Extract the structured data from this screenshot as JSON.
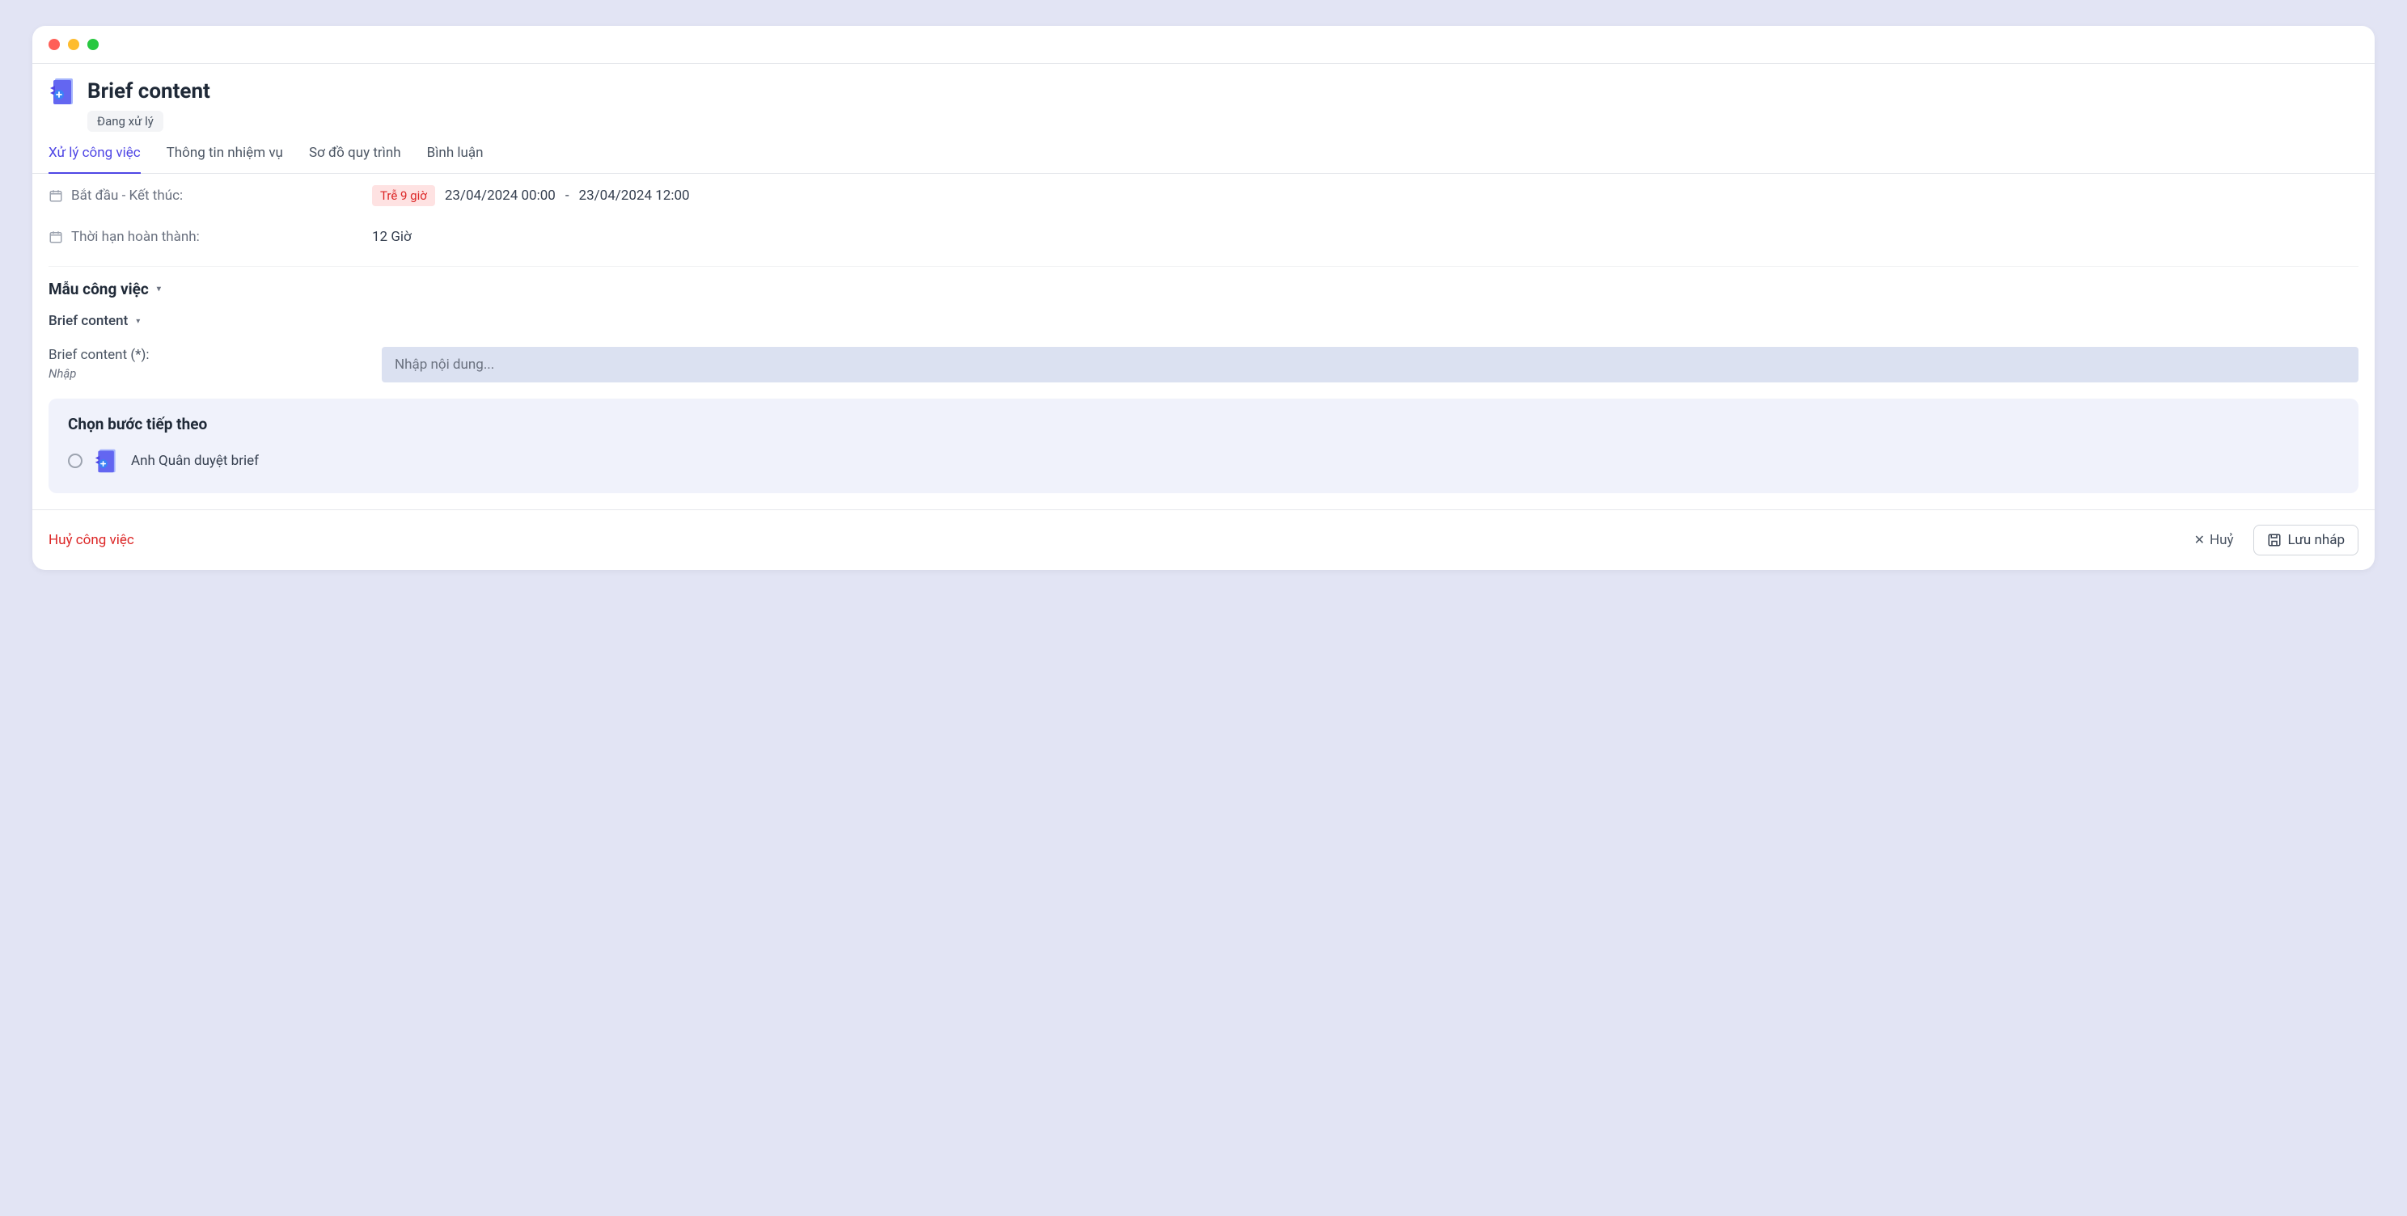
{
  "title": "Brief content",
  "status_badge": "Đang xử lý",
  "tabs": [
    {
      "label": "Xử lý công việc",
      "active": true
    },
    {
      "label": "Thông tin nhiệm vụ",
      "active": false
    },
    {
      "label": "Sơ đồ quy trình",
      "active": false
    },
    {
      "label": "Bình luận",
      "active": false
    }
  ],
  "info": {
    "start_end_label": "Bắt đầu - Kết thúc:",
    "late_badge": "Trễ 9 giờ",
    "start_date": "23/04/2024 00:00",
    "dash": "-",
    "end_date": "23/04/2024 12:00",
    "deadline_label": "Thời hạn hoàn thành:",
    "deadline_value": "12 Giờ"
  },
  "template_section": "Mẫu công việc",
  "template_sub": "Brief content",
  "form": {
    "label": "Brief content (*):",
    "hint": "Nhập",
    "placeholder": "Nhập nội dung..."
  },
  "next_step": {
    "title": "Chọn bước tiếp theo",
    "option_label": "Anh Quân duyệt brief"
  },
  "footer": {
    "cancel_job": "Huỷ công việc",
    "cancel": "Huỷ",
    "save_draft": "Lưu nháp"
  }
}
